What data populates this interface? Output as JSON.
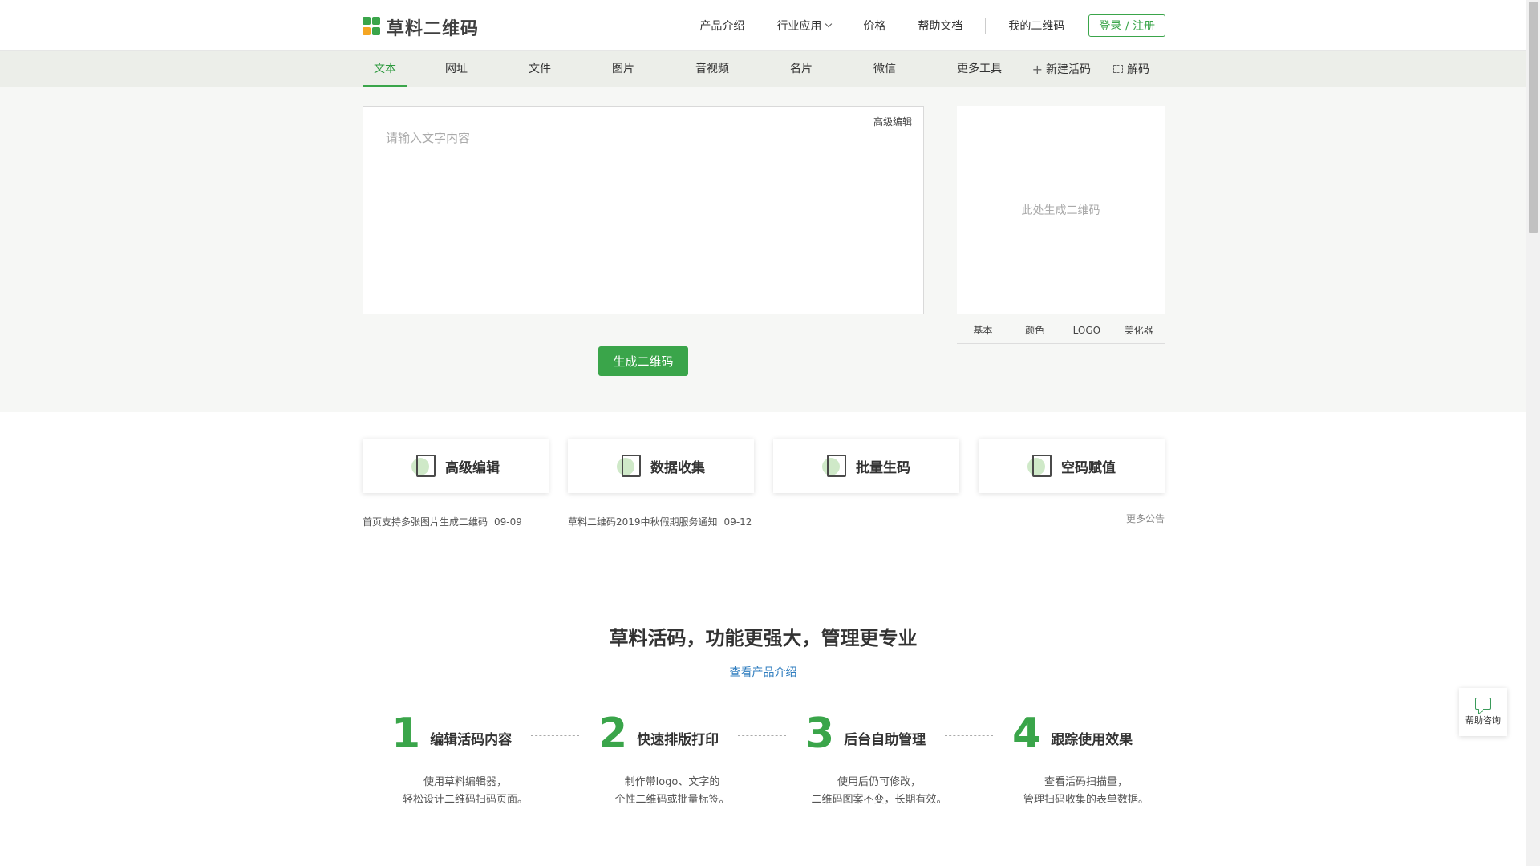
{
  "brand": {
    "name": "草料二维码",
    "colors": {
      "primary": "#3aa54a",
      "logo_top_left": "#3aa54a",
      "logo_top_right": "#3aa54a",
      "logo_bottom_left": "#f5a623",
      "logo_bottom_right": "#3aa54a"
    }
  },
  "topnav": {
    "items": [
      "产品介绍",
      "行业应用",
      "价格",
      "帮助文档"
    ],
    "my_codes": "我的二维码",
    "login": "登录 / 注册"
  },
  "tabs": {
    "items": [
      "文本",
      "网址",
      "文件",
      "图片",
      "音视频",
      "名片",
      "微信",
      "更多工具"
    ],
    "active": "文本",
    "new_dynamic": "新建活码",
    "decode": "解码"
  },
  "editor": {
    "placeholder": "请输入文字内容",
    "advanced_edit": "高级编辑",
    "generate": "生成二维码"
  },
  "preview": {
    "placeholder": "此处生成二维码",
    "tabs": [
      "基本",
      "颜色",
      "LOGO",
      "美化器"
    ]
  },
  "features": [
    {
      "label": "高级编辑",
      "icon": "image-edit-icon"
    },
    {
      "label": "数据收集",
      "icon": "form-edit-icon"
    },
    {
      "label": "批量生码",
      "icon": "batch-add-icon"
    },
    {
      "label": "空码赋值",
      "icon": "phone-assign-icon"
    }
  ],
  "notices": [
    {
      "text": "首页支持多张图片生成二维码",
      "date": "09-09"
    },
    {
      "text": "草料二维码2019中秋假期服务通知",
      "date": "09-12"
    }
  ],
  "more_notices": "更多公告",
  "promo": {
    "title": "草料活码，功能更强大，管理更专业",
    "link": "查看产品介绍",
    "steps": [
      {
        "num": "1",
        "title": "编辑活码内容",
        "desc1": "使用草料编辑器，",
        "desc2": "轻松设计二维码扫码页面。"
      },
      {
        "num": "2",
        "title": "快速排版打印",
        "desc1": "制作带logo、文字的",
        "desc2": "个性二维码或批量标签。"
      },
      {
        "num": "3",
        "title": "后台自助管理",
        "desc1": "使用后仍可修改，",
        "desc2": "二维码图案不变，长期有效。"
      },
      {
        "num": "4",
        "title": "跟踪使用效果",
        "desc1": "查看活码扫描量，",
        "desc2": "管理扫码收集的表单数据。"
      }
    ]
  },
  "help_float": "帮助咨询"
}
